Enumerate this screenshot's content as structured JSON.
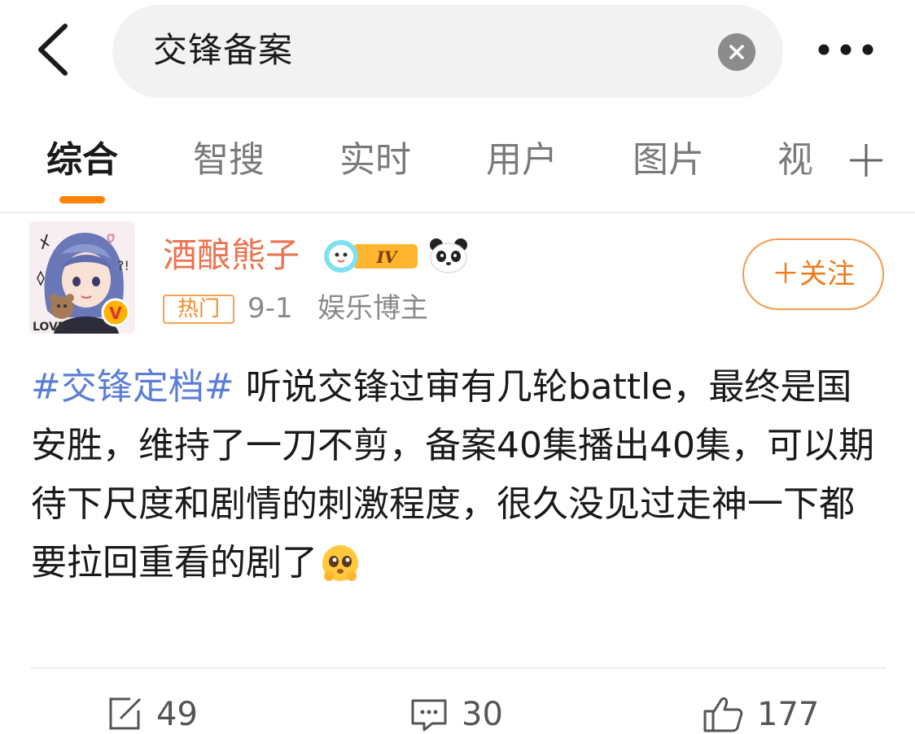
{
  "search": {
    "query": "交锋备案"
  },
  "tabs": [
    {
      "label": "综合",
      "active": true
    },
    {
      "label": "智搜",
      "active": false
    },
    {
      "label": "实时",
      "active": false
    },
    {
      "label": "用户",
      "active": false
    },
    {
      "label": "图片",
      "active": false
    },
    {
      "label": "视频",
      "active": false
    }
  ],
  "post": {
    "author": "酒酿熊子",
    "level_badge": "IV",
    "hot_tag": "热门",
    "date": "9-1",
    "role": "娱乐博主",
    "follow_label": "＋关注",
    "hashtag": "#交锋定档#",
    "text": " 听说交锋过审有几轮battle，最终是国安胜，维持了一刀不剪，备案40集播出40集，可以期待下尺度和剧情的刺激程度，很久没见过走神一下都要拉回重看的剧了",
    "emoji": "hopeful-face-emoji"
  },
  "actions": {
    "repost_count": "49",
    "comment_count": "30",
    "like_count": "177"
  },
  "icons": {
    "back": "chevron-left-icon",
    "clear": "close-circle-icon",
    "more": "more-dots-icon",
    "add_tab": "plus-icon",
    "repost": "repost-icon",
    "comment": "comment-icon",
    "like": "thumbs-up-icon",
    "verified": "verified-v-icon",
    "panda": "panda-icon"
  },
  "colors": {
    "accent": "#ff8200",
    "username": "#eb7350",
    "hashtag": "#5b7fd6",
    "follow": "#f07a1a"
  }
}
